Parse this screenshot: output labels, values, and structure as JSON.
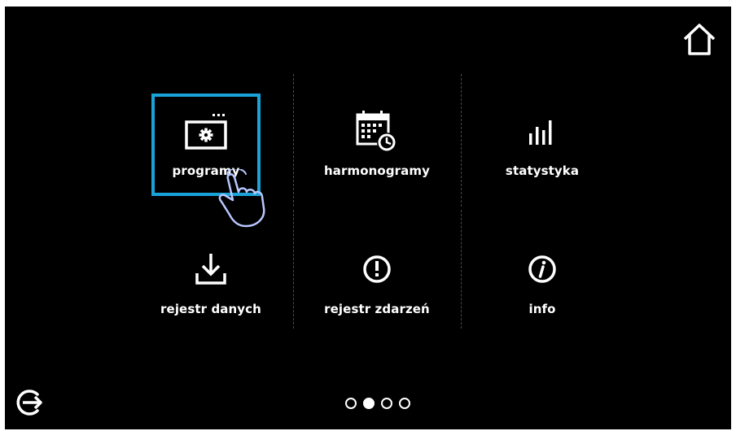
{
  "colors": {
    "background": "#000000",
    "text": "#ffffff",
    "selection": "#1aa3d8",
    "hand_outline": "#b8c8ff"
  },
  "header": {
    "home_icon": "home-icon"
  },
  "footer": {
    "exit_icon": "exit-icon",
    "active_page": 2,
    "page_count": 4
  },
  "menu": {
    "items": [
      {
        "label": "programy",
        "icon": "program-settings-icon",
        "selected": true
      },
      {
        "label": "harmonogramy",
        "icon": "calendar-clock-icon",
        "selected": false
      },
      {
        "label": "statystyka",
        "icon": "bar-chart-icon",
        "selected": false
      },
      {
        "label": "rejestr danych",
        "icon": "download-icon",
        "selected": false
      },
      {
        "label": "rejestr zdarzeń",
        "icon": "exclamation-circle-icon",
        "selected": false
      },
      {
        "label": "info",
        "icon": "info-circle-icon",
        "selected": false
      }
    ]
  }
}
